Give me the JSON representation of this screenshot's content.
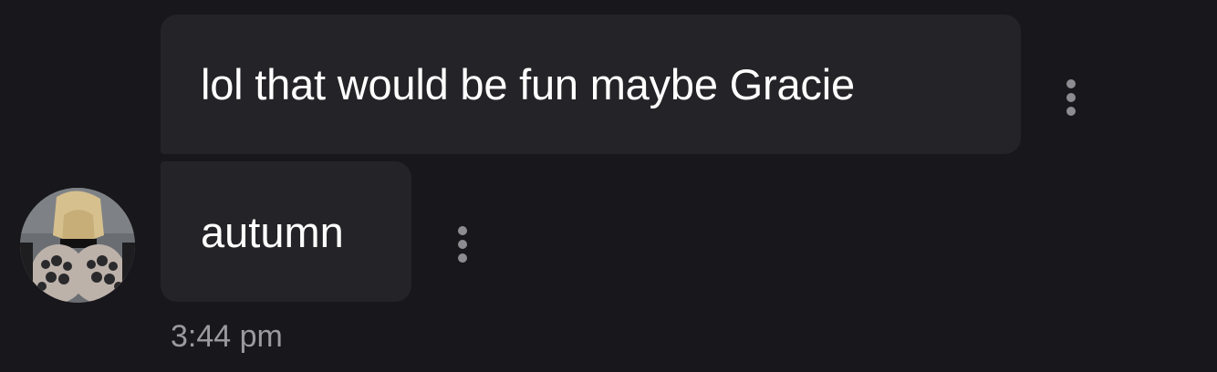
{
  "messages": [
    {
      "text": "lol that would be fun maybe Gracie"
    },
    {
      "text": "autumn"
    }
  ],
  "timestamp": "3:44 pm",
  "icons": {
    "more": "more-vertical-icon"
  },
  "colors": {
    "background": "#18171b",
    "bubble": "#242428",
    "text": "#ffffff",
    "timestamp": "#9a9aa0",
    "icon": "#8c8c92"
  }
}
